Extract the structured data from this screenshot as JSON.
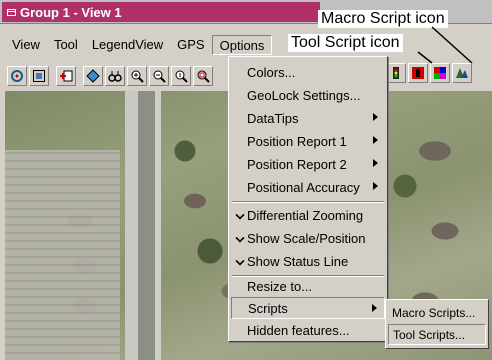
{
  "window": {
    "title": "Group 1 - View 1"
  },
  "callouts": {
    "macro": "Macro Script icon",
    "tool": "Tool Script icon"
  },
  "menubar": [
    {
      "label": "View"
    },
    {
      "label": "Tool"
    },
    {
      "label": "LegendView"
    },
    {
      "label": "GPS"
    },
    {
      "label": "Options"
    }
  ],
  "toolbar": {
    "icons": [
      "target-icon",
      "frame-icon",
      "layer-add-icon",
      "diamond-icon",
      "binoculars-icon",
      "zoom-in-icon",
      "zoom-out-icon",
      "zoom-1to1-icon",
      "zoom-box-icon"
    ],
    "right_icons": [
      "traffic-light-icon",
      "macro-script-icon",
      "tool-script-icon",
      "map-icon"
    ]
  },
  "options_menu": {
    "items": [
      {
        "label": "Colors..."
      },
      {
        "label": "GeoLock Settings..."
      },
      {
        "label": "DataTips",
        "submenu": true
      },
      {
        "label": "Position Report 1",
        "submenu": true
      },
      {
        "label": "Position Report 2",
        "submenu": true
      },
      {
        "label": "Positional Accuracy",
        "submenu": true
      },
      {
        "label": "Differential Zooming",
        "checked": true
      },
      {
        "label": "Show Scale/Position",
        "checked": true
      },
      {
        "label": "Show Status Line",
        "checked": true
      },
      {
        "label": "Resize to..."
      },
      {
        "label": "Scripts",
        "submenu": true,
        "highlighted": true
      },
      {
        "label": "Hidden features..."
      }
    ]
  },
  "scripts_submenu": {
    "items": [
      {
        "label": "Macro Scripts..."
      },
      {
        "label": "Tool Scripts...",
        "highlighted": true
      }
    ]
  },
  "colors": {
    "titlebar": "#b0306a",
    "face": "#d4d0c8"
  }
}
